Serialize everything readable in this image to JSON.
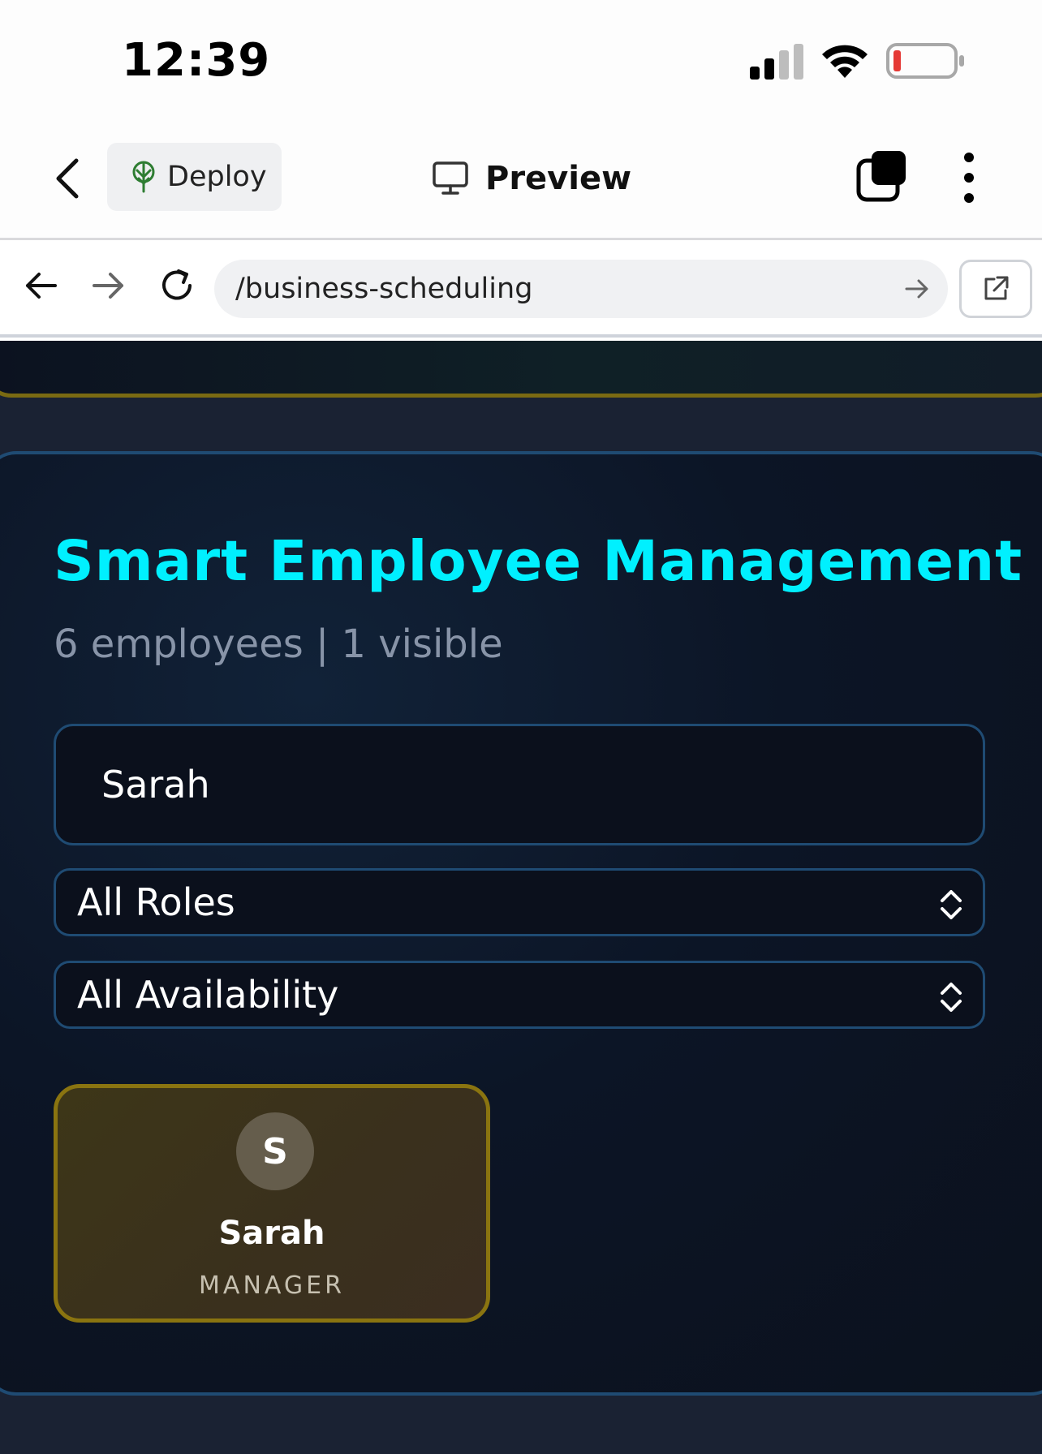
{
  "status_bar": {
    "time": "12:39"
  },
  "toolbar": {
    "deploy_label": "Deploy",
    "preview_label": "Preview",
    "icons": [
      "back-chevron-icon",
      "deploy-tree-icon",
      "monitor-icon",
      "tabs-icon",
      "more-vertical-icon"
    ]
  },
  "browser": {
    "url": "/business-scheduling",
    "icons": [
      "back-arrow-icon",
      "forward-arrow-icon",
      "reload-icon",
      "go-arrow-icon",
      "open-external-icon"
    ]
  },
  "page": {
    "title": "Smart Employee Management",
    "subtitle": "6 employees | 1 visible",
    "search_value": "Sarah",
    "role_filter": {
      "selected": "All Roles"
    },
    "availability_filter": {
      "selected": "All Availability"
    },
    "employees": [
      {
        "initial": "S",
        "name": "Sarah",
        "role": "MANAGER"
      }
    ]
  },
  "colors": {
    "title_accent": "#00f0ff",
    "card_border_gold": "#8a7410",
    "panel_border_blue": "#1f4b73",
    "background_dark": "#0b111d",
    "battery_low": "#e53935"
  }
}
